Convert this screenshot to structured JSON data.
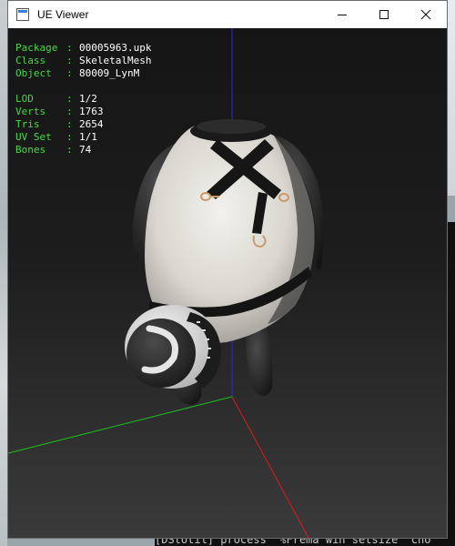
{
  "window": {
    "title": "UE Viewer",
    "controls": {
      "minimize": "—",
      "maximize": "☐",
      "close": "✕"
    }
  },
  "overlay": {
    "package": {
      "key": "Package",
      "sep": ": ",
      "value": "00005963.upk"
    },
    "class": {
      "key": "Class  ",
      "sep": ": ",
      "value": "SkeletalMesh"
    },
    "object": {
      "key": "Object ",
      "sep": ": ",
      "value": "80009_LynM"
    },
    "lod": {
      "key": "LOD    ",
      "sep": ": ",
      "value": "1/2"
    },
    "verts": {
      "key": "Verts  ",
      "sep": ": ",
      "value": "1763"
    },
    "tris": {
      "key": "Tris   ",
      "sep": ": ",
      "value": "2654"
    },
    "uvset": {
      "key": "UV Set ",
      "sep": ": ",
      "value": "1/1"
    },
    "bones": {
      "key": "Bones  ",
      "sep": ": ",
      "value": "74"
    }
  },
  "background_console": {
    "bottom_line": "[DStotil] process  %Frema win setsize  cho"
  },
  "colors": {
    "axis_x": "#e01b1b",
    "axis_y": "#16c716",
    "axis_z": "#2a2ae6",
    "label_key": "#49d649",
    "label_value": "#ffffff"
  }
}
